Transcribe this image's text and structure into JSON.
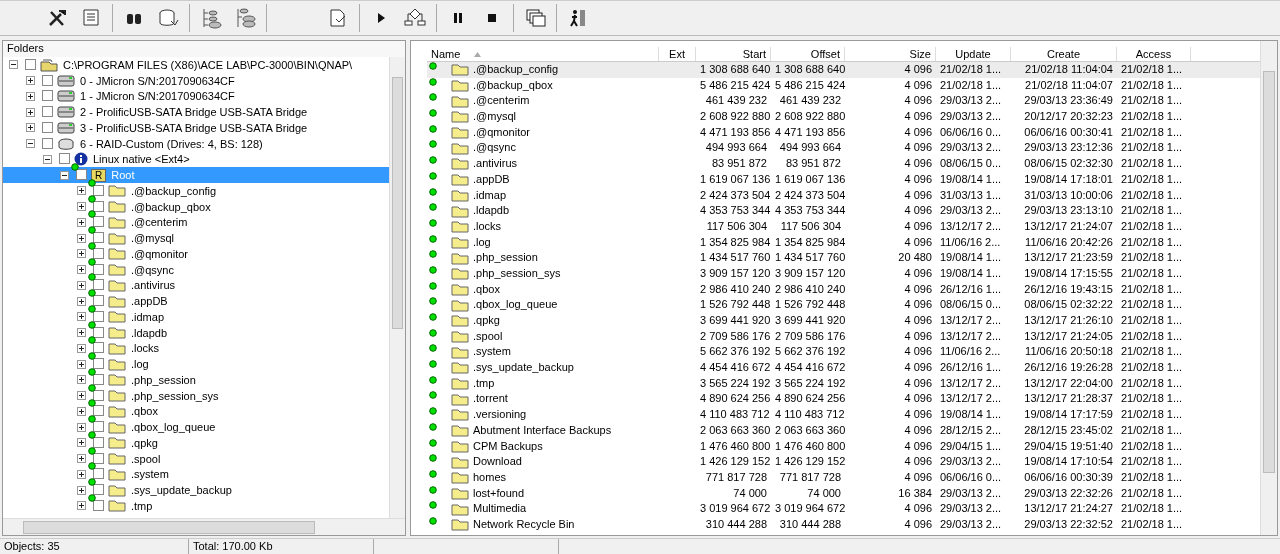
{
  "tree": {
    "title": "Folders",
    "items": [
      {
        "kind": "path",
        "label": "C:\\PROGRAM FILES (X86)\\ACE LAB\\PC-3000\\BIN\\QNAP\\",
        "expanded": true,
        "checked": false,
        "selected": false,
        "children": [
          {
            "kind": "drive",
            "label": "0 - JMicron S/N:2017090634CF",
            "expanded": false,
            "checked": false,
            "selected": false
          },
          {
            "kind": "drive",
            "label": "1 - JMicron S/N:2017090634CF",
            "expanded": false,
            "checked": false,
            "selected": false
          },
          {
            "kind": "drive",
            "label": "2 - ProlificUSB-SATA Bridge USB-SATA Bridge",
            "expanded": false,
            "checked": false,
            "selected": false
          },
          {
            "kind": "drive",
            "label": "3 - ProlificUSB-SATA Bridge USB-SATA Bridge",
            "expanded": false,
            "checked": false,
            "selected": false
          },
          {
            "kind": "raid",
            "label": "6 - RAID-Custom (Drives: 4, BS: 128)",
            "expanded": true,
            "checked": false,
            "selected": false,
            "children": [
              {
                "kind": "partition",
                "label": "Linux native <Ext4>",
                "expanded": true,
                "checked": false,
                "selected": false,
                "children": [
                  {
                    "kind": "root",
                    "label": "Root",
                    "badge": "R",
                    "expanded": true,
                    "checked": false,
                    "selected": true,
                    "children": [
                      {
                        "kind": "folder",
                        "label": ".@backup_config",
                        "expanded": false,
                        "checked": false,
                        "selected": false
                      },
                      {
                        "kind": "folder",
                        "label": ".@backup_qbox",
                        "expanded": false,
                        "checked": false,
                        "selected": false
                      },
                      {
                        "kind": "folder",
                        "label": ".@centerim",
                        "expanded": false,
                        "checked": false,
                        "selected": false
                      },
                      {
                        "kind": "folder",
                        "label": ".@mysql",
                        "expanded": false,
                        "checked": false,
                        "selected": false
                      },
                      {
                        "kind": "folder",
                        "label": ".@qmonitor",
                        "expanded": false,
                        "checked": false,
                        "selected": false
                      },
                      {
                        "kind": "folder",
                        "label": ".@qsync",
                        "expanded": false,
                        "checked": false,
                        "selected": false
                      },
                      {
                        "kind": "folder",
                        "label": ".antivirus",
                        "expanded": false,
                        "checked": false,
                        "selected": false
                      },
                      {
                        "kind": "folder",
                        "label": ".appDB",
                        "expanded": false,
                        "checked": false,
                        "selected": false
                      },
                      {
                        "kind": "folder",
                        "label": ".idmap",
                        "expanded": false,
                        "checked": false,
                        "selected": false
                      },
                      {
                        "kind": "folder",
                        "label": ".ldapdb",
                        "expanded": false,
                        "checked": false,
                        "selected": false
                      },
                      {
                        "kind": "folder",
                        "label": ".locks",
                        "expanded": false,
                        "checked": false,
                        "selected": false
                      },
                      {
                        "kind": "folder",
                        "label": ".log",
                        "expanded": false,
                        "checked": false,
                        "selected": false
                      },
                      {
                        "kind": "folder",
                        "label": ".php_session",
                        "expanded": false,
                        "checked": false,
                        "selected": false
                      },
                      {
                        "kind": "folder",
                        "label": ".php_session_sys",
                        "expanded": false,
                        "checked": false,
                        "selected": false
                      },
                      {
                        "kind": "folder",
                        "label": ".qbox",
                        "expanded": false,
                        "checked": false,
                        "selected": false
                      },
                      {
                        "kind": "folder",
                        "label": ".qbox_log_queue",
                        "expanded": false,
                        "checked": false,
                        "selected": false
                      },
                      {
                        "kind": "folder",
                        "label": ".qpkg",
                        "expanded": false,
                        "checked": false,
                        "selected": false
                      },
                      {
                        "kind": "folder",
                        "label": ".spool",
                        "expanded": false,
                        "checked": false,
                        "selected": false
                      },
                      {
                        "kind": "folder",
                        "label": ".system",
                        "expanded": false,
                        "checked": false,
                        "selected": false
                      },
                      {
                        "kind": "folder",
                        "label": ".sys_update_backup",
                        "expanded": false,
                        "checked": false,
                        "selected": false
                      },
                      {
                        "kind": "folder",
                        "label": ".tmp",
                        "expanded": false,
                        "checked": false,
                        "selected": false
                      }
                    ]
                  }
                ]
              }
            ]
          }
        ]
      }
    ]
  },
  "table": {
    "columns": [
      "Name",
      "Ext",
      "Start",
      "Offset",
      "Size",
      "Update",
      "Create",
      "Access"
    ],
    "rows": [
      {
        "selected": true,
        "name": ".@backup_config",
        "start": "1 308 688 640",
        "offset": "1 308 688 640",
        "size": "4 096",
        "update": "21/02/18 1...",
        "create": "21/02/18 11:04:04",
        "access": "21/02/18 1..."
      },
      {
        "selected": false,
        "name": ".@backup_qbox",
        "start": "5 486 215 424",
        "offset": "5 486 215 424",
        "size": "4 096",
        "update": "21/02/18 1...",
        "create": "21/02/18 11:04:07",
        "access": "21/02/18 1..."
      },
      {
        "selected": false,
        "name": ".@centerim",
        "start": "461 439 232",
        "offset": "461 439 232",
        "size": "4 096",
        "update": "29/03/13 2...",
        "create": "29/03/13 23:36:49",
        "access": "21/02/18 1..."
      },
      {
        "selected": false,
        "name": ".@mysql",
        "start": "2 608 922 880",
        "offset": "2 608 922 880",
        "size": "4 096",
        "update": "29/03/13 2...",
        "create": "20/12/17 20:32:23",
        "access": "21/02/18 1..."
      },
      {
        "selected": false,
        "name": ".@qmonitor",
        "start": "4 471 193 856",
        "offset": "4 471 193 856",
        "size": "4 096",
        "update": "06/06/16 0...",
        "create": "06/06/16 00:30:41",
        "access": "21/02/18 1..."
      },
      {
        "selected": false,
        "name": ".@qsync",
        "start": "494 993 664",
        "offset": "494 993 664",
        "size": "4 096",
        "update": "29/03/13 2...",
        "create": "29/03/13 23:12:36",
        "access": "21/02/18 1..."
      },
      {
        "selected": false,
        "name": ".antivirus",
        "start": "83 951 872",
        "offset": "83 951 872",
        "size": "4 096",
        "update": "08/06/15 0...",
        "create": "08/06/15 02:32:30",
        "access": "21/02/18 1..."
      },
      {
        "selected": false,
        "name": ".appDB",
        "start": "1 619 067 136",
        "offset": "1 619 067 136",
        "size": "4 096",
        "update": "19/08/14 1...",
        "create": "19/08/14 17:18:01",
        "access": "21/02/18 1..."
      },
      {
        "selected": false,
        "name": ".idmap",
        "start": "2 424 373 504",
        "offset": "2 424 373 504",
        "size": "4 096",
        "update": "31/03/13 1...",
        "create": "31/03/13 10:00:06",
        "access": "21/02/18 1..."
      },
      {
        "selected": false,
        "name": ".ldapdb",
        "start": "4 353 753 344",
        "offset": "4 353 753 344",
        "size": "4 096",
        "update": "29/03/13 2...",
        "create": "29/03/13 23:13:10",
        "access": "21/02/18 1..."
      },
      {
        "selected": false,
        "name": ".locks",
        "start": "117 506 304",
        "offset": "117 506 304",
        "size": "4 096",
        "update": "13/12/17 2...",
        "create": "13/12/17 21:24:07",
        "access": "21/02/18 1..."
      },
      {
        "selected": false,
        "name": ".log",
        "start": "1 354 825 984",
        "offset": "1 354 825 984",
        "size": "4 096",
        "update": "11/06/16 2...",
        "create": "11/06/16 20:42:26",
        "access": "21/02/18 1..."
      },
      {
        "selected": false,
        "name": ".php_session",
        "start": "1 434 517 760",
        "offset": "1 434 517 760",
        "size": "20 480",
        "update": "19/08/14 1...",
        "create": "13/12/17 21:23:59",
        "access": "21/02/18 1..."
      },
      {
        "selected": false,
        "name": ".php_session_sys",
        "start": "3 909 157 120",
        "offset": "3 909 157 120",
        "size": "4 096",
        "update": "19/08/14 1...",
        "create": "19/08/14 17:15:55",
        "access": "21/02/18 1..."
      },
      {
        "selected": false,
        "name": ".qbox",
        "start": "2 986 410 240",
        "offset": "2 986 410 240",
        "size": "4 096",
        "update": "26/12/16 1...",
        "create": "26/12/16 19:43:15",
        "access": "21/02/18 1..."
      },
      {
        "selected": false,
        "name": ".qbox_log_queue",
        "start": "1 526 792 448",
        "offset": "1 526 792 448",
        "size": "4 096",
        "update": "08/06/15 0...",
        "create": "08/06/15 02:32:22",
        "access": "21/02/18 1..."
      },
      {
        "selected": false,
        "name": ".qpkg",
        "start": "3 699 441 920",
        "offset": "3 699 441 920",
        "size": "4 096",
        "update": "13/12/17 2...",
        "create": "13/12/17 21:26:10",
        "access": "21/02/18 1..."
      },
      {
        "selected": false,
        "name": ".spool",
        "start": "2 709 586 176",
        "offset": "2 709 586 176",
        "size": "4 096",
        "update": "13/12/17 2...",
        "create": "13/12/17 21:24:05",
        "access": "21/02/18 1..."
      },
      {
        "selected": false,
        "name": ".system",
        "start": "5 662 376 192",
        "offset": "5 662 376 192",
        "size": "4 096",
        "update": "11/06/16 2...",
        "create": "11/06/16 20:50:18",
        "access": "21/02/18 1..."
      },
      {
        "selected": false,
        "name": ".sys_update_backup",
        "start": "4 454 416 672",
        "offset": "4 454 416 672",
        "size": "4 096",
        "update": "26/12/16 1...",
        "create": "26/12/16 19:26:28",
        "access": "21/02/18 1..."
      },
      {
        "selected": false,
        "name": ".tmp",
        "start": "3 565 224 192",
        "offset": "3 565 224 192",
        "size": "4 096",
        "update": "13/12/17 2...",
        "create": "13/12/17 22:04:00",
        "access": "21/02/18 1..."
      },
      {
        "selected": false,
        "name": ".torrent",
        "start": "4 890 624 256",
        "offset": "4 890 624 256",
        "size": "4 096",
        "update": "13/12/17 2...",
        "create": "13/12/17 21:28:37",
        "access": "21/02/18 1..."
      },
      {
        "selected": false,
        "name": ".versioning",
        "start": "4 110 483 712",
        "offset": "4 110 483 712",
        "size": "4 096",
        "update": "19/08/14 1...",
        "create": "19/08/14 17:17:59",
        "access": "21/02/18 1..."
      },
      {
        "selected": false,
        "name": "Abutment Interface Backups",
        "start": "2 063 663 360",
        "offset": "2 063 663 360",
        "size": "4 096",
        "update": "28/12/15 2...",
        "create": "28/12/15 23:45:02",
        "access": "21/02/18 1..."
      },
      {
        "selected": false,
        "name": "CPM Backups",
        "start": "1 476 460 800",
        "offset": "1 476 460 800",
        "size": "4 096",
        "update": "29/04/15 1...",
        "create": "29/04/15 19:51:40",
        "access": "21/02/18 1..."
      },
      {
        "selected": false,
        "name": "Download",
        "start": "1 426 129 152",
        "offset": "1 426 129 152",
        "size": "4 096",
        "update": "29/03/13 2...",
        "create": "19/08/14 17:10:54",
        "access": "21/02/18 1..."
      },
      {
        "selected": false,
        "name": "homes",
        "start": "771 817 728",
        "offset": "771 817 728",
        "size": "4 096",
        "update": "06/06/16 0...",
        "create": "06/06/16 00:30:39",
        "access": "21/02/18 1..."
      },
      {
        "selected": false,
        "name": "lost+found",
        "start": "74 000",
        "offset": "74 000",
        "size": "16 384",
        "update": "29/03/13 2...",
        "create": "29/03/13 22:32:26",
        "access": "21/02/18 1..."
      },
      {
        "selected": false,
        "name": "Multimedia",
        "start": "3 019 964 672",
        "offset": "3 019 964 672",
        "size": "4 096",
        "update": "29/03/13 2...",
        "create": "13/12/17 21:24:27",
        "access": "21/02/18 1..."
      },
      {
        "selected": false,
        "name": "Network Recycle Bin",
        "start": "310 444 288",
        "offset": "310 444 288",
        "size": "4 096",
        "update": "29/03/13 2...",
        "create": "29/03/13 22:32:52",
        "access": "21/02/18 1..."
      }
    ]
  },
  "status_bar": [
    "Objects: 35",
    "Total: 170.00 Kb"
  ]
}
